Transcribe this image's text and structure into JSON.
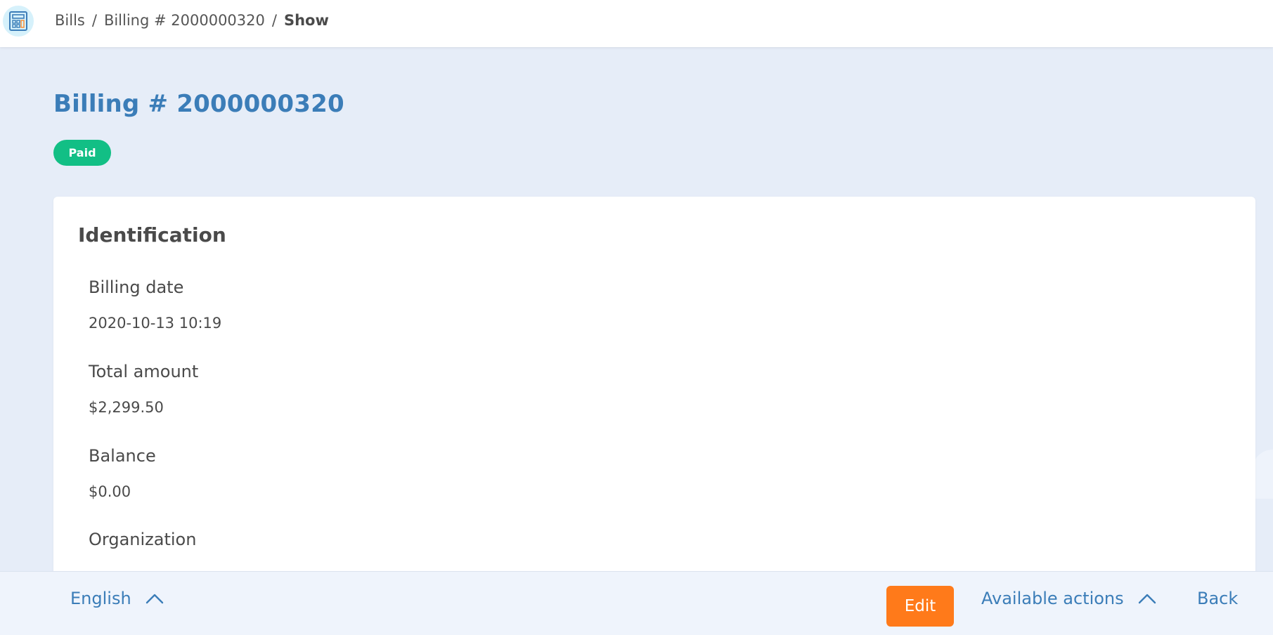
{
  "header": {
    "breadcrumb": {
      "items": [
        "Bills",
        "Billing # 2000000320",
        "Show"
      ],
      "separator": "/"
    }
  },
  "page": {
    "title": "Billing # 2000000320",
    "status": "Paid",
    "status_color": "#12bf85"
  },
  "identification": {
    "title": "Identification",
    "fields": [
      {
        "label": "Billing date",
        "value": "2020-10-13 10:19"
      },
      {
        "label": "Total amount",
        "value": "$2,299.50"
      },
      {
        "label": "Balance",
        "value": "$0.00"
      },
      {
        "label": "Organization",
        "value": ""
      }
    ]
  },
  "footer": {
    "language": "English",
    "edit_label": "Edit",
    "actions_label": "Available actions",
    "back_label": "Back"
  },
  "colors": {
    "accent": "#3b7db8",
    "edit_button": "#ff7a1a",
    "background": "#e6edf8"
  },
  "icons": {
    "app": "calculator-icon",
    "language_toggle": "chevron-up-icon",
    "actions_toggle": "chevron-up-icon"
  }
}
